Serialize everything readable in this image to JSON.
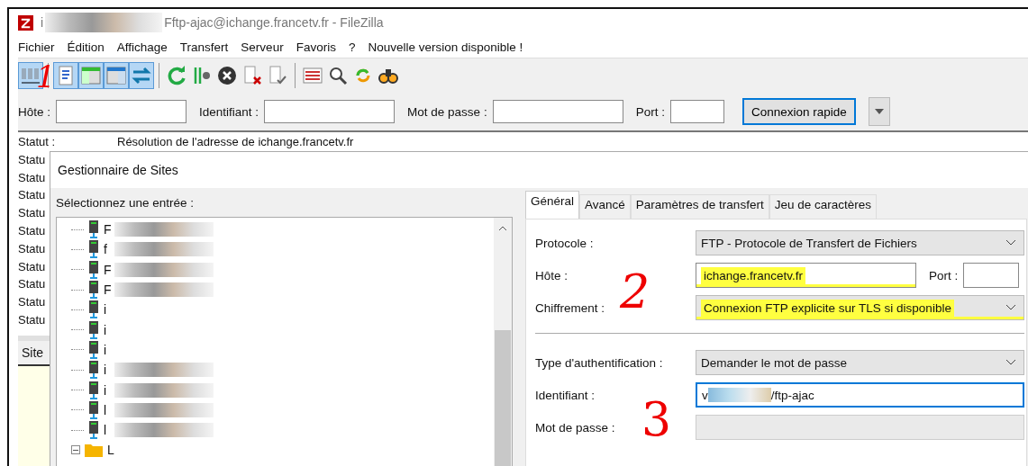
{
  "window": {
    "title_start": "i",
    "title_end": "Fftp-ajac@ichange.francetv.fr - FileZilla"
  },
  "menu": [
    "Fichier",
    "Édition",
    "Affichage",
    "Transfert",
    "Serveur",
    "Favoris",
    "?",
    "Nouvelle version disponible !"
  ],
  "toolbar": [
    {
      "kind": "site-manager",
      "pressed": true
    },
    {
      "kind": "separator"
    },
    {
      "kind": "message-log",
      "pressed": true
    },
    {
      "kind": "local-tree",
      "pressed": true
    },
    {
      "kind": "remote-tree",
      "pressed": true
    },
    {
      "kind": "queue",
      "pressed": true
    },
    {
      "kind": "separator"
    },
    {
      "kind": "refresh",
      "pressed": false
    },
    {
      "kind": "filter",
      "pressed": false
    },
    {
      "kind": "cancel",
      "pressed": false
    },
    {
      "kind": "disconnect",
      "pressed": false
    },
    {
      "kind": "reconnect",
      "pressed": false
    },
    {
      "kind": "separator"
    },
    {
      "kind": "compare",
      "pressed": false
    },
    {
      "kind": "search",
      "pressed": false
    },
    {
      "kind": "sync",
      "pressed": false
    },
    {
      "kind": "find",
      "pressed": false
    }
  ],
  "quickconnect": {
    "host_label": "Hôte :",
    "user_label": "Identifiant :",
    "password_label": "Mot de passe :",
    "port_label": "Port :",
    "button": "Connexion rapide"
  },
  "status_log": [
    {
      "label": "Statut :",
      "message": "Résolution de l'adresse de ichange.francetv.fr"
    },
    {
      "label": "Statu"
    },
    {
      "label": "Statu"
    },
    {
      "label": "Statu"
    },
    {
      "label": "Statu"
    },
    {
      "label": "Statu"
    },
    {
      "label": "Statu"
    },
    {
      "label": "Statu"
    },
    {
      "label": "Statu"
    },
    {
      "label": "Statu"
    },
    {
      "label": "Statu"
    }
  ],
  "site_panel": {
    "label": "Site"
  },
  "dialog": {
    "title": "Gestionnaire de Sites",
    "select_label": "Sélectionnez une entrée :",
    "tree": [
      {
        "kind": "server",
        "text": "F",
        "redacted": true
      },
      {
        "kind": "server",
        "text": "f",
        "redacted": true
      },
      {
        "kind": "server",
        "text": "F",
        "redacted": true
      },
      {
        "kind": "server",
        "text": "F",
        "redacted": true
      },
      {
        "kind": "server",
        "text": "i",
        "redacted": false
      },
      {
        "kind": "server",
        "text": "i",
        "redacted": false
      },
      {
        "kind": "server",
        "text": "i",
        "redacted": false
      },
      {
        "kind": "server",
        "text": "i",
        "redacted": true
      },
      {
        "kind": "server",
        "text": "i",
        "redacted": true
      },
      {
        "kind": "server",
        "text": "l",
        "redacted": true
      },
      {
        "kind": "server",
        "text": "l",
        "redacted": true
      },
      {
        "kind": "folder",
        "text": "L",
        "redacted": false
      }
    ],
    "tabs": [
      {
        "label": "Général",
        "selected": true
      },
      {
        "label": "Avancé",
        "selected": false
      },
      {
        "label": "Paramètres de transfert",
        "selected": false
      },
      {
        "label": "Jeu de caractères",
        "selected": false
      }
    ],
    "fields": [
      {
        "kind": "select",
        "label": "Protocole :",
        "value": "FTP - Protocole de Transfert de Fichiers",
        "highlighted": false,
        "focused": false,
        "disabled": false
      },
      {
        "kind": "host",
        "label": "Hôte :",
        "value": "ichange.francetv.fr",
        "highlighted": true,
        "focused": false,
        "disabled": false,
        "port_label": "Port :"
      },
      {
        "kind": "select",
        "label": "Chiffrement :",
        "value": "Connexion FTP explicite sur TLS si disponible",
        "highlighted": true,
        "focused": false,
        "disabled": false
      },
      {
        "kind": "divider"
      },
      {
        "kind": "select",
        "label": "Type d'authentification :",
        "value": "Demander le mot de passe",
        "highlighted": false,
        "focused": false,
        "disabled": false
      },
      {
        "kind": "user",
        "label": "Identifiant :",
        "value_start": "v",
        "value_end": "/ftp-ajac",
        "highlighted": false,
        "focused": true,
        "disabled": false
      },
      {
        "kind": "text",
        "label": "Mot de passe :",
        "highlighted": false,
        "focused": false,
        "disabled": true
      }
    ]
  },
  "annotations": [
    "1",
    "2",
    "3"
  ]
}
